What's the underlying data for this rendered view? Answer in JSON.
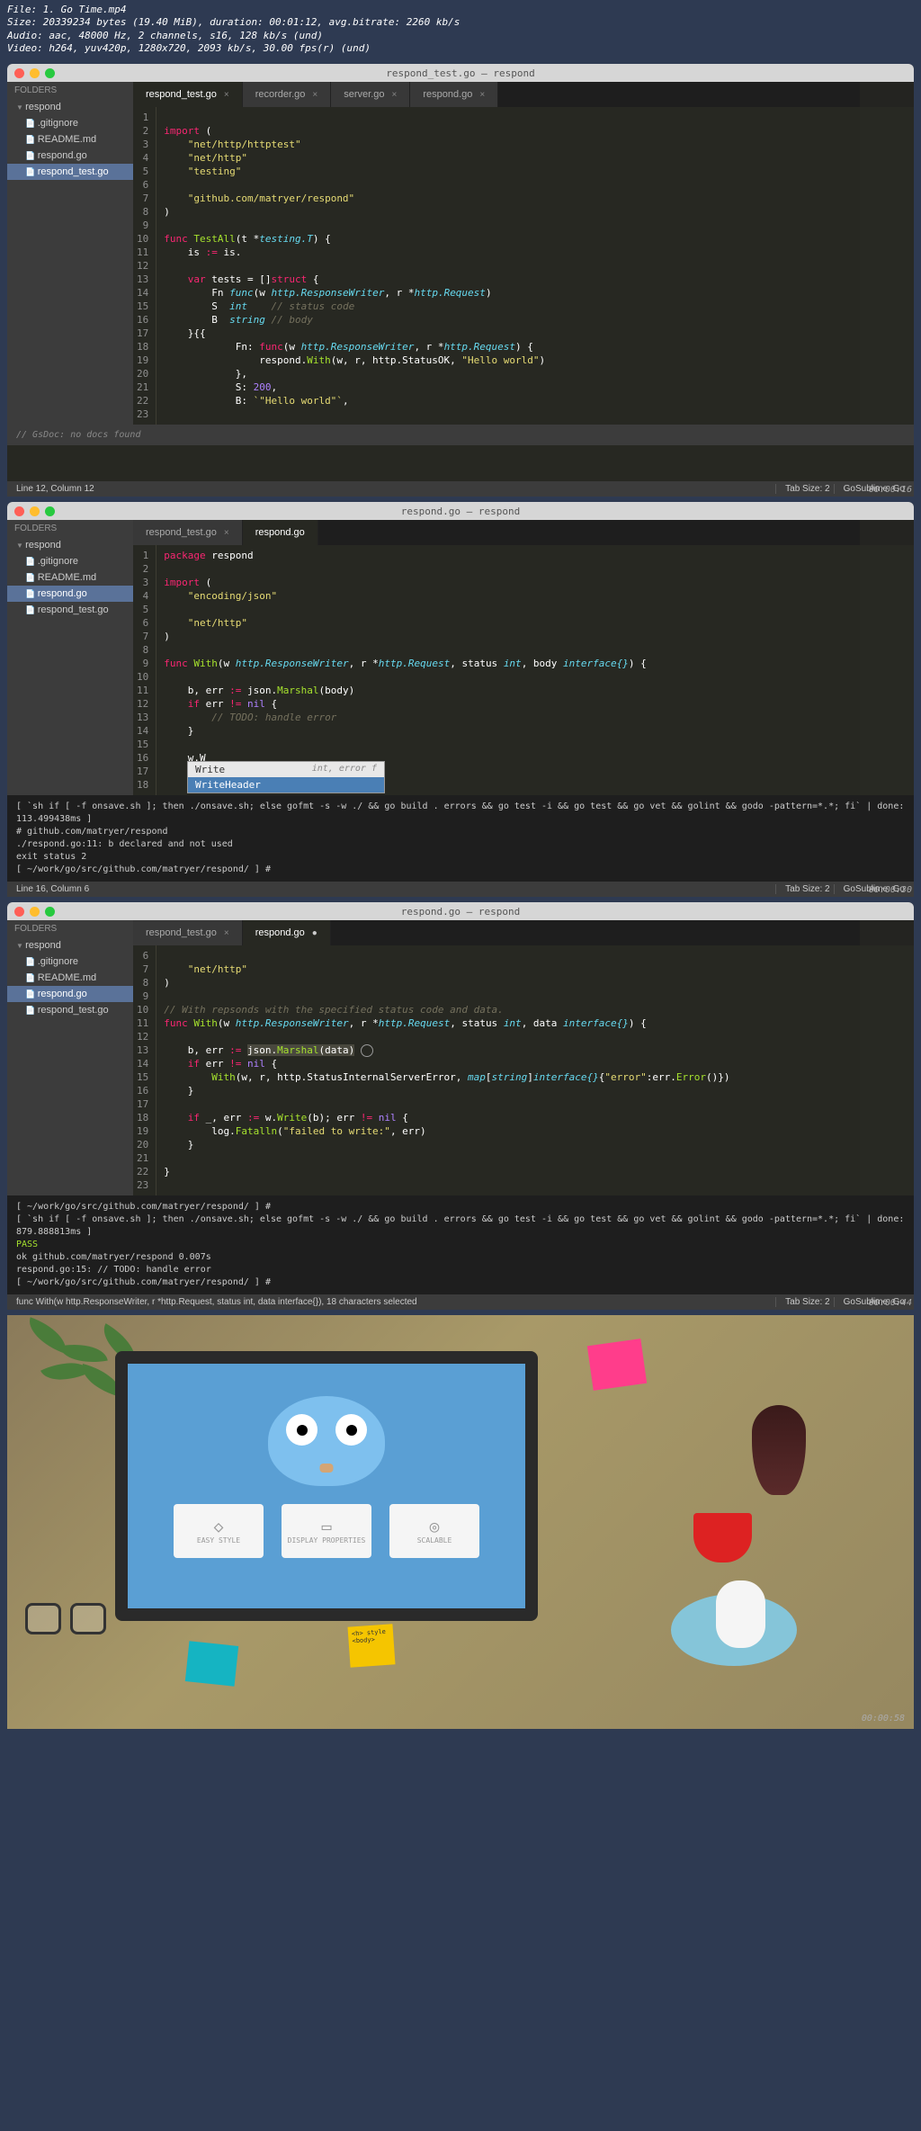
{
  "header": {
    "file": "File: 1. Go Time.mp4",
    "size": "Size: 20339234 bytes (19.40 MiB), duration: 00:01:12, avg.bitrate: 2260 kb/s",
    "audio": "Audio: aac, 48000 Hz, 2 channels, s16, 128 kb/s (und)",
    "video": "Video: h264, yuv420p, 1280x720, 2093 kb/s, 30.00 fps(r) (und)"
  },
  "window1": {
    "title": "respond_test.go — respond",
    "timestamp": "00:00:16",
    "sidebar": {
      "label": "FOLDERS",
      "root": "respond",
      "files": [
        ".gitignore",
        "README.md",
        "respond.go",
        "respond_test.go"
      ],
      "selected": "respond_test.go"
    },
    "tabs": [
      {
        "name": "respond_test.go",
        "active": true
      },
      {
        "name": "recorder.go",
        "active": false
      },
      {
        "name": "server.go",
        "active": false
      },
      {
        "name": "respond.go",
        "active": false
      }
    ],
    "docs": "// GsDoc: no docs found",
    "status_left": "Line 12, Column 12",
    "status_tab": "Tab Size: 2",
    "status_lang": "GoSublime: Go",
    "code_lines": [
      "1",
      "2",
      "3",
      "4",
      "5",
      "6",
      "7",
      "8",
      "9",
      "10",
      "11",
      "12",
      "13",
      "14",
      "15",
      "16",
      "17",
      "18",
      "19",
      "20",
      "21",
      "22",
      "23"
    ]
  },
  "window2": {
    "title": "respond.go — respond",
    "timestamp": "00:00:30",
    "sidebar": {
      "label": "FOLDERS",
      "root": "respond",
      "files": [
        ".gitignore",
        "README.md",
        "respond.go",
        "respond_test.go"
      ],
      "selected": "respond.go"
    },
    "tabs": [
      {
        "name": "respond_test.go",
        "active": false
      },
      {
        "name": "respond.go",
        "active": true
      }
    ],
    "autocomplete": [
      {
        "name": "Write",
        "type": "int, error f"
      },
      {
        "name": "WriteHeader",
        "type": "",
        "selected": true
      }
    ],
    "console_lines": [
      "[ `sh if [ -f onsave.sh ]; then ./onsave.sh; else gofmt -s -w ./ && go build . errors && go test -i && go test && go vet && golint && godo -pattern=*.*; fi` | done: 113.499438ms ]",
      "# github.com/matryer/respond",
      "./respond.go:11: b declared and not used",
      "",
      "exit status 2",
      "[ ~/work/go/src/github.com/matryer/respond/ ] #"
    ],
    "status_left": "Line 16, Column 6",
    "status_tab": "Tab Size: 2",
    "status_lang": "GoSublime: Go",
    "code_lines": [
      "1",
      "2",
      "3",
      "4",
      "5",
      "6",
      "7",
      "8",
      "9",
      "10",
      "11",
      "12",
      "13",
      "14",
      "15",
      "16",
      "17",
      "18"
    ]
  },
  "window3": {
    "title": "respond.go — respond",
    "timestamp": "00:00:44",
    "sidebar": {
      "label": "FOLDERS",
      "root": "respond",
      "files": [
        ".gitignore",
        "README.md",
        "respond.go",
        "respond_test.go"
      ],
      "selected": "respond.go"
    },
    "tabs": [
      {
        "name": "respond_test.go",
        "active": false
      },
      {
        "name": "respond.go",
        "active": true,
        "dirty": true
      }
    ],
    "console_lines": [
      "[ ~/work/go/src/github.com/matryer/respond/ ] #",
      "[ `sh if [ -f onsave.sh ]; then ./onsave.sh; else gofmt -s -w ./ && go build . errors && go test -i && go test && go vet && golint && godo -pattern=*.*; fi` | done: 879.888813ms ]",
      "  PASS",
      "  ok      github.com/matryer/respond  0.007s",
      "  respond.go:15: // TODO: handle error",
      "[ ~/work/go/src/github.com/matryer/respond/ ] #"
    ],
    "status_left": "func With(w http.ResponseWriter, r *http.Request, status int, data interface{}), 18 characters selected",
    "status_tab": "Tab Size: 2",
    "status_lang": "GoSublime: Go",
    "code_lines": [
      "6",
      "7",
      "8",
      "9",
      "10",
      "11",
      "12",
      "13",
      "14",
      "15",
      "16",
      "17",
      "18",
      "19",
      "20",
      "21",
      "22",
      "23"
    ]
  },
  "photo": {
    "timestamp": "00:00:58",
    "cards": [
      "EASY STYLE",
      "DISPLAY PROPERTIES",
      "SCALABLE"
    ],
    "sticky_code": "<h> \nstyle \n<body>"
  }
}
